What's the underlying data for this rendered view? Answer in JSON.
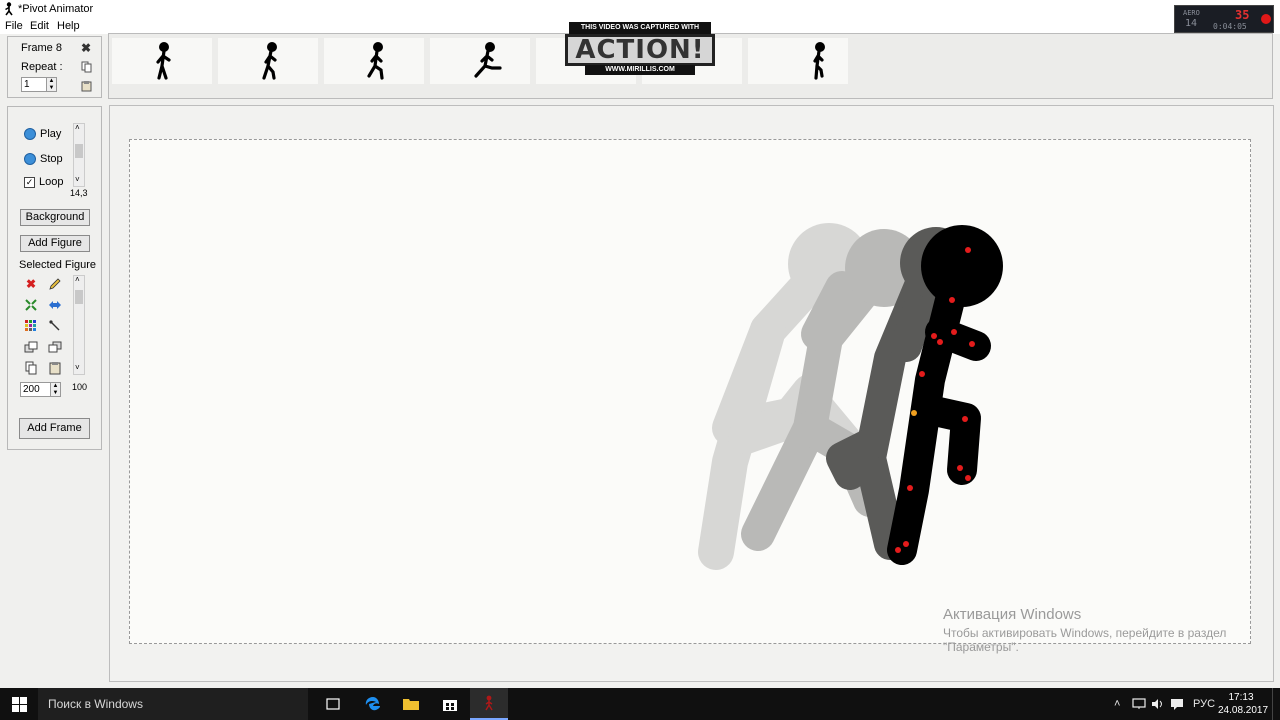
{
  "window": {
    "title": "*Pivot Animator"
  },
  "menu": [
    "File",
    "Edit",
    "Help"
  ],
  "recorder": {
    "label": "AERO",
    "fps": "14",
    "counter": "35",
    "time": "0:04:05"
  },
  "frame_panel": {
    "frame_label": "Frame 8",
    "repeat_label": "Repeat :",
    "repeat_value": "1"
  },
  "watermark": {
    "caption": "THIS VIDEO WAS CAPTURED WITH",
    "logo": "ACTION!",
    "url": "WWW.MIRILLIS.COM"
  },
  "controls": {
    "play": "Play",
    "stop": "Stop",
    "loop": "Loop",
    "speed": "14,3",
    "background": "Background",
    "add_figure": "Add Figure",
    "selected_figure": "Selected Figure",
    "scale_value": "200",
    "opacity_value": "100",
    "add_frame": "Add Frame"
  },
  "activation": {
    "title": "Активация Windows",
    "line1": "Чтобы активировать Windows, перейдите в раздел",
    "line2": "\"Параметры\"."
  },
  "taskbar": {
    "search": "Поиск в Windows",
    "lang": "РУС",
    "time": "17:13",
    "date": "24.08.2017"
  }
}
